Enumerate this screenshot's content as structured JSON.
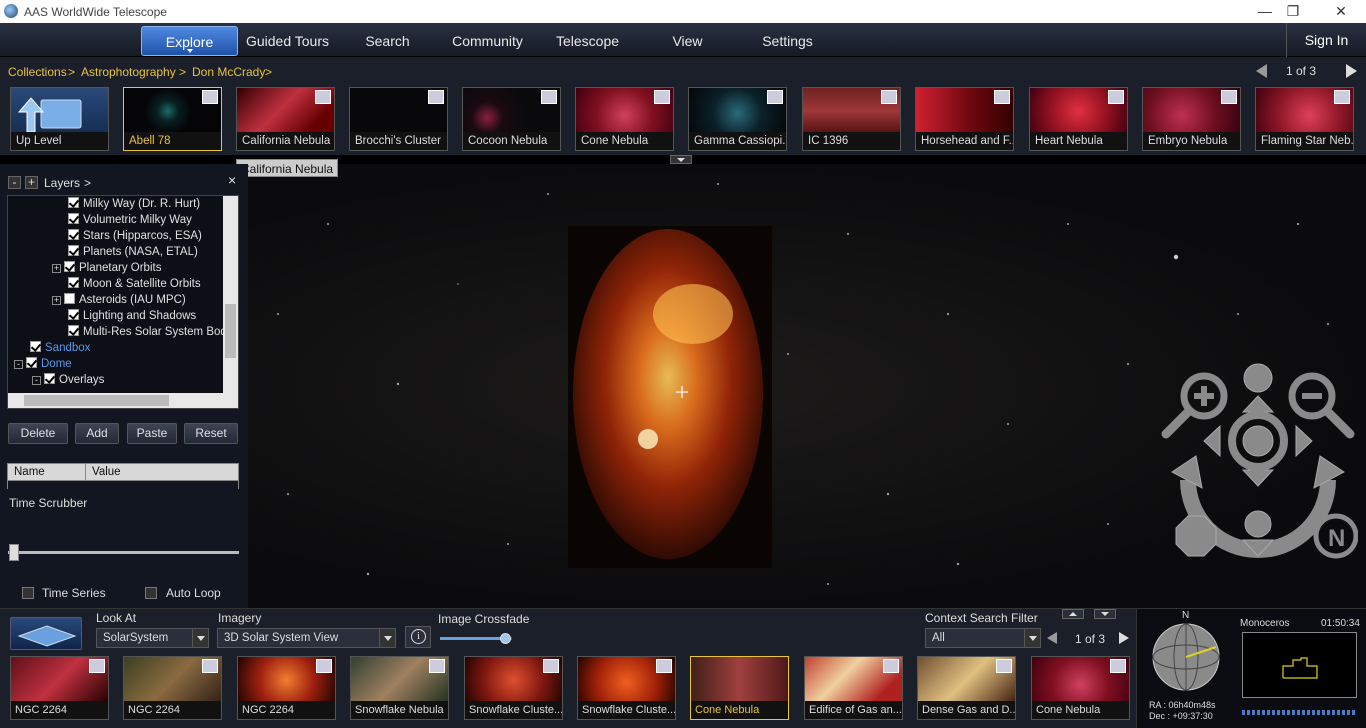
{
  "window": {
    "title": "AAS WorldWide Telescope",
    "minimize": "—",
    "restore": "❐",
    "close": "✕"
  },
  "menu": {
    "tabs": [
      {
        "label": "Explore"
      },
      {
        "label": "Guided Tours"
      },
      {
        "label": "Search"
      },
      {
        "label": "Community"
      },
      {
        "label": "Telescope"
      },
      {
        "label": "View"
      },
      {
        "label": "Settings"
      }
    ],
    "signin": "Sign In"
  },
  "breadcrumb": {
    "items": [
      "Collections",
      ">",
      "Astrophotography",
      ">",
      "Don McCrady",
      ">"
    ],
    "page": "1 of 3"
  },
  "thumbs": [
    {
      "label": "Up Level"
    },
    {
      "label": "Abell 78"
    },
    {
      "label": "California Nebula"
    },
    {
      "label": "Brocchi's Cluster"
    },
    {
      "label": "Cocoon Nebula"
    },
    {
      "label": "Cone Nebula"
    },
    {
      "label": "Gamma Cassiopi..."
    },
    {
      "label": "IC 1396"
    },
    {
      "label": "Horsehead and F..."
    },
    {
      "label": "Heart Nebula"
    },
    {
      "label": "Embryo Nebula"
    },
    {
      "label": "Flaming Star Neb..."
    }
  ],
  "tooltip": "California Nebula",
  "layers": {
    "title": "Layers",
    "title_arrow": ">",
    "minus": "-",
    "plus": "+",
    "close": "×",
    "items": [
      {
        "label": "Milky Way (Dr. R. Hurt)"
      },
      {
        "label": "Volumetric Milky Way"
      },
      {
        "label": "Stars (Hipparcos, ESA)"
      },
      {
        "label": "Planets (NASA, ETAL)"
      },
      {
        "label": "Planetary Orbits"
      },
      {
        "label": "Moon & Satellite Orbits"
      },
      {
        "label": "Asteroids (IAU MPC)"
      },
      {
        "label": "Lighting and Shadows"
      },
      {
        "label": "Multi-Res Solar System Bodies"
      },
      {
        "label": "Sandbox"
      },
      {
        "label": "Dome"
      },
      {
        "label": "Overlays"
      }
    ],
    "buttons": {
      "delete": "Delete",
      "add": "Add",
      "paste": "Paste",
      "reset": "Reset"
    },
    "columns": {
      "name": "Name",
      "value": "Value"
    },
    "time_scrubber": "Time Scrubber",
    "time_series": "Time Series",
    "auto_loop": "Auto Loop"
  },
  "bottom": {
    "look_at_label": "Look At",
    "look_at_value": "SolarSystem",
    "imagery_label": "Imagery",
    "imagery_value": "3D Solar System View",
    "info": "i",
    "crossfade_label": "Image Crossfade",
    "crossfade": 0.9,
    "filter_label": "Context Search Filter",
    "filter_value": "All",
    "page": "1 of 3",
    "thumbs": [
      {
        "label": "NGC 2264"
      },
      {
        "label": "NGC 2264"
      },
      {
        "label": "NGC 2264"
      },
      {
        "label": "Snowflake Nebula"
      },
      {
        "label": "Snowflake Cluste..."
      },
      {
        "label": "Snowflake Cluste..."
      },
      {
        "label": "Cone Nebula"
      },
      {
        "label": "Edifice of Gas an..."
      },
      {
        "label": "Dense Gas and D..."
      },
      {
        "label": "Cone Nebula"
      }
    ],
    "compass_n": "N",
    "ra": "RA :  06h40m48s",
    "dec": "Dec : +09:37:30",
    "constellation": "Monoceros",
    "clock": "01:50:34"
  }
}
